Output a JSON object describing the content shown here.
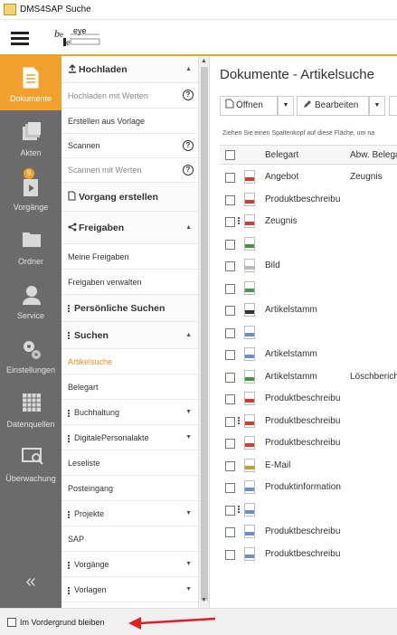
{
  "app": {
    "title": "DMS4SAP Suche"
  },
  "header": {
    "logo_text": "eye"
  },
  "sidebar": {
    "items": [
      {
        "label": "Dokumente",
        "icon": "document-icon",
        "active": true
      },
      {
        "label": "Akten",
        "icon": "folders-icon"
      },
      {
        "label": "Vorgänge",
        "icon": "process-icon",
        "badge": "9"
      },
      {
        "label": "Ordner",
        "icon": "folder-icon"
      },
      {
        "label": "Service",
        "icon": "person-icon"
      },
      {
        "label": "Einstellungen",
        "icon": "gears-icon"
      },
      {
        "label": "Datenquellen",
        "icon": "grid-icon"
      },
      {
        "label": "Überwachung",
        "icon": "monitor-icon"
      }
    ],
    "collapse": "«"
  },
  "menu": {
    "hochladen": "Hochladen",
    "hochladen_werte": "Hochladen mit Werten",
    "erstellen_vorlage": "Erstellen aus Vorlage",
    "scannen": "Scannen",
    "scannen_werte": "Scannen mit Werten",
    "vorgang_erstellen": "Vorgang erstellen",
    "freigaben": "Freigaben",
    "meine_freigaben": "Meine Freigaben",
    "freigaben_verwalten": "Freigaben verwalten",
    "persoenliche_suchen": "Persönliche Suchen",
    "suchen": "Suchen",
    "artikelsuche": "Artikelsuche",
    "belegart": "Belegart",
    "buchhaltung": "Buchhaltung",
    "digitale_personalakte": "DigitalePersonalakte",
    "leseliste": "Leseliste",
    "posteingang": "Posteingang",
    "projekte": "Projekte",
    "sap": "SAP",
    "vorgaenge": "Vorgänge",
    "vorlagen": "Vorlagen"
  },
  "main": {
    "title": "Dokumente - Artikelsuche",
    "open_label": "Öffnen",
    "edit_label": "Bearbeiten",
    "hint": "Ziehen Sie einen Spaltenkopf auf diese Fläche, um na",
    "col_belegart": "Belegart",
    "col_abw": "Abw. Belega",
    "rows": [
      {
        "type": "pdf",
        "belegart": "Angebot",
        "abw": "Zeugnis",
        "dots": false
      },
      {
        "type": "pdf",
        "belegart": "Produktbeschreibu",
        "abw": "",
        "dots": false
      },
      {
        "type": "pdf",
        "belegart": "Zeugnis",
        "abw": "",
        "dots": true
      },
      {
        "type": "xls",
        "belegart": "",
        "abw": "",
        "dots": false
      },
      {
        "type": "img",
        "belegart": "Bild",
        "abw": "",
        "dots": false
      },
      {
        "type": "jpg",
        "belegart": "",
        "abw": "",
        "dots": false
      },
      {
        "type": "tif",
        "belegart": "Artikelstamm",
        "abw": "",
        "dots": false
      },
      {
        "type": "doc",
        "belegart": "",
        "abw": "",
        "dots": false
      },
      {
        "type": "doc",
        "belegart": "Artikelstamm",
        "abw": "",
        "dots": false
      },
      {
        "type": "xls",
        "belegart": "Artikelstamm",
        "abw": "Löschbericht",
        "dots": false
      },
      {
        "type": "pdf",
        "belegart": "Produktbeschreibu",
        "abw": "",
        "dots": false
      },
      {
        "type": "pdf",
        "belegart": "Produktbeschreibu",
        "abw": "",
        "dots": true
      },
      {
        "type": "pdf",
        "belegart": "Produktbeschreibu",
        "abw": "",
        "dots": false
      },
      {
        "type": "mail",
        "belegart": "E-Mail",
        "abw": "",
        "dots": false
      },
      {
        "type": "doc",
        "belegart": "Produktinformation",
        "abw": "",
        "dots": false
      },
      {
        "type": "doc",
        "belegart": "",
        "abw": "",
        "dots": true
      },
      {
        "type": "doc",
        "belegart": "Produktbeschreibu",
        "abw": "",
        "dots": false
      },
      {
        "type": "doc",
        "belegart": "Produktbeschreibu",
        "abw": "",
        "dots": false
      }
    ]
  },
  "footer": {
    "stay_on_top": "Im Vordergrund bleiben"
  },
  "colors": {
    "accent": "#f0a02c",
    "sidebar": "#6b6b6b",
    "link": "#e2901e",
    "arrow": "#e02020"
  }
}
